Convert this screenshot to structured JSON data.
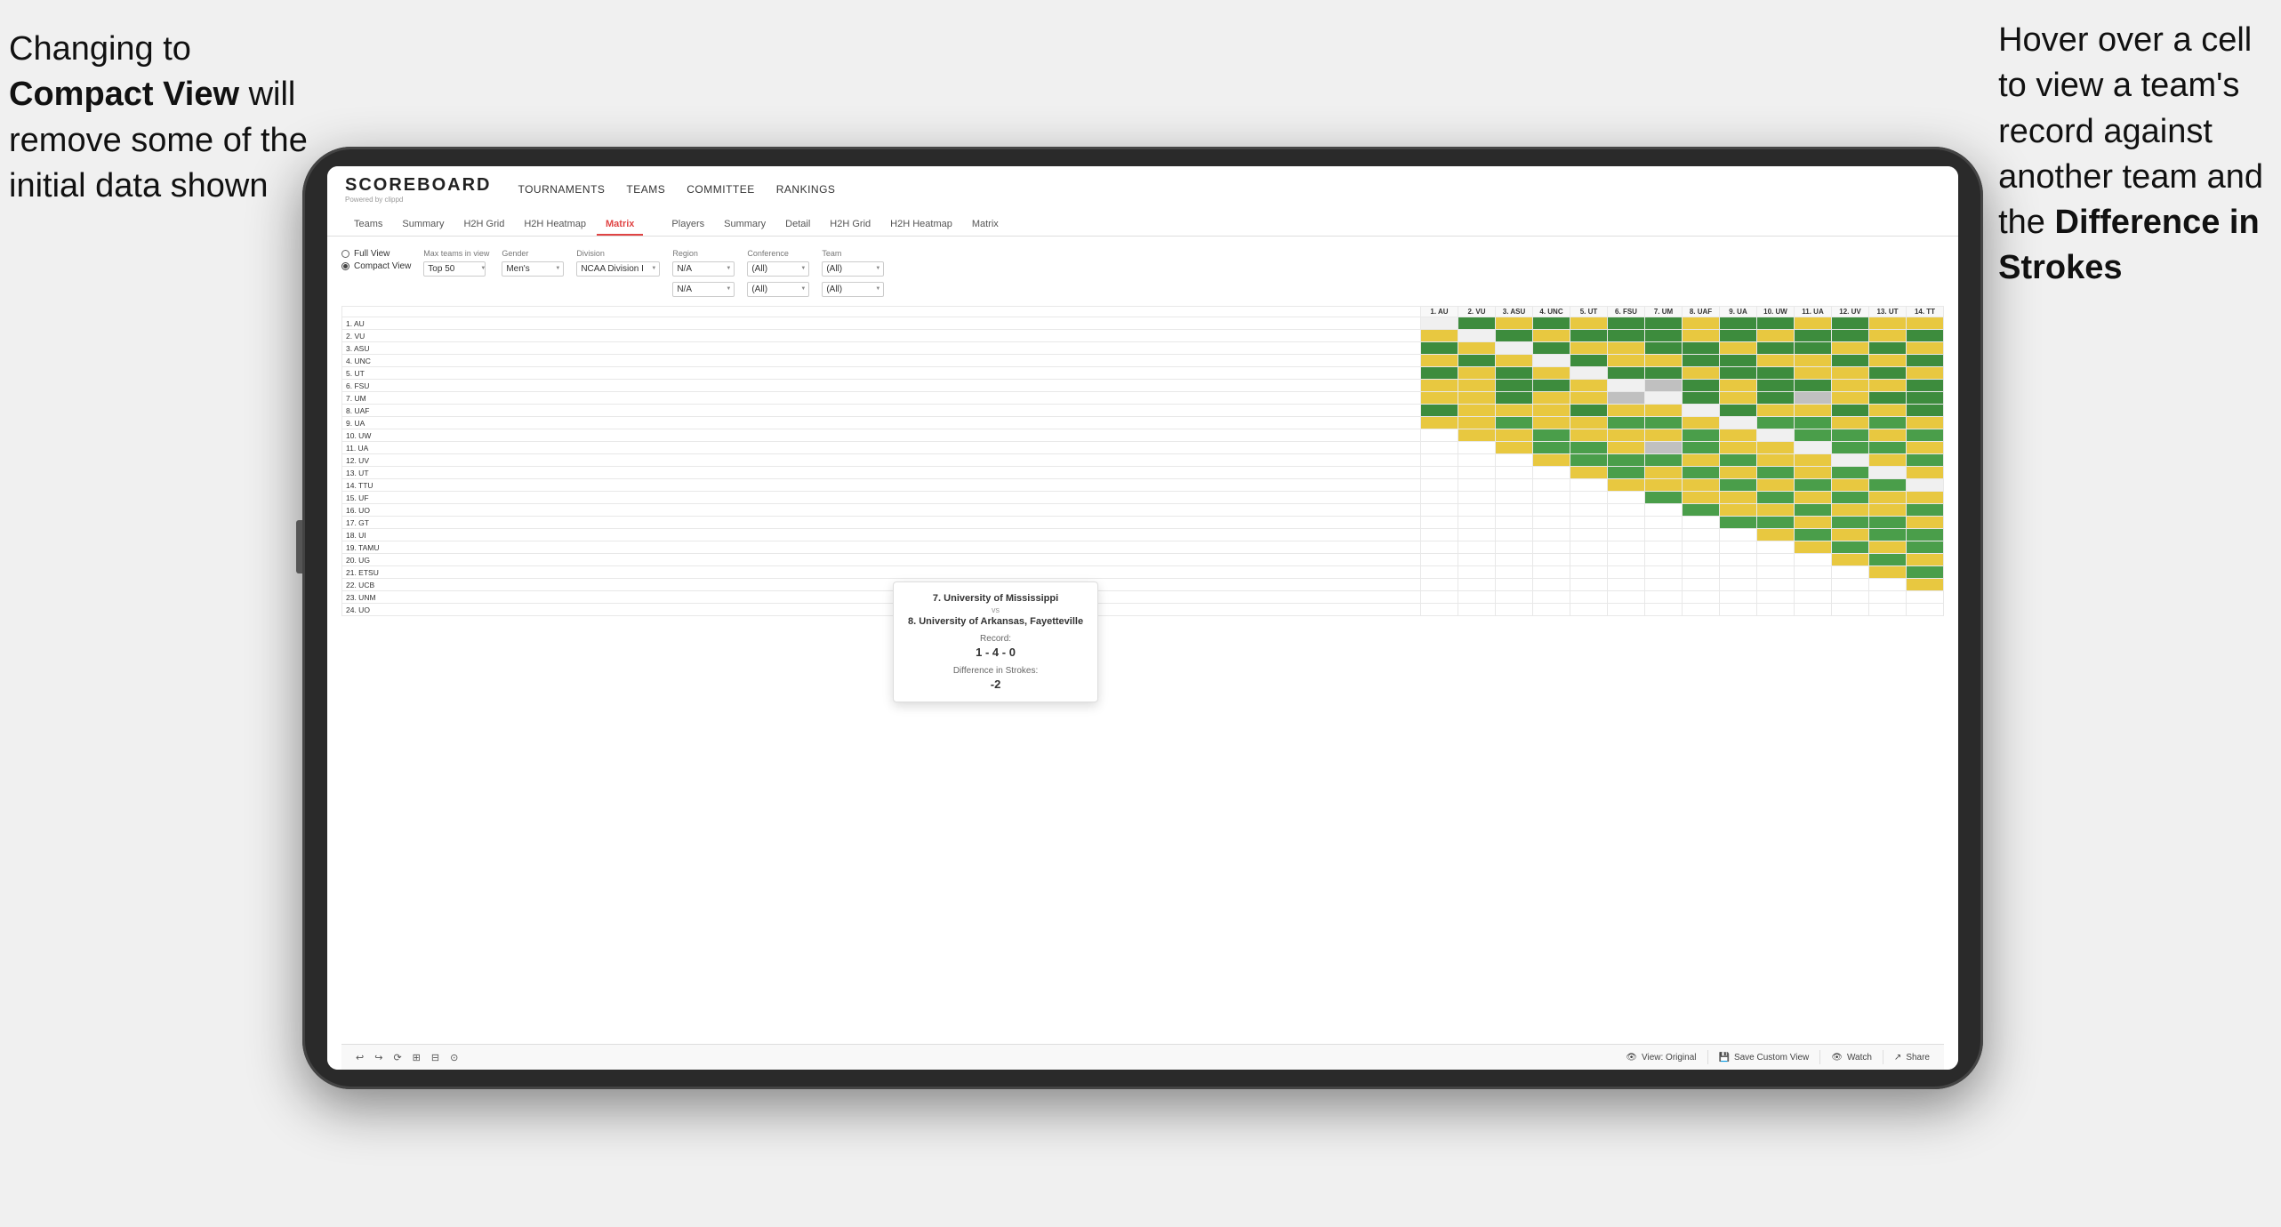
{
  "annotation_left": {
    "line1": "Changing to",
    "line2_bold": "Compact View",
    "line2_rest": " will",
    "line3": "remove some of the",
    "line4": "initial data shown"
  },
  "annotation_right": {
    "line1": "Hover over a cell",
    "line2": "to view a team's",
    "line3": "record against",
    "line4": "another team and",
    "line5_pre": "the ",
    "line5_bold": "Difference in",
    "line6_bold": "Strokes"
  },
  "nav": {
    "logo": "SCOREBOARD",
    "logo_sub": "Powered by clippd",
    "links": [
      "TOURNAMENTS",
      "TEAMS",
      "COMMITTEE",
      "RANKINGS"
    ]
  },
  "sub_tabs": {
    "group1": [
      "Teams",
      "Summary",
      "H2H Grid",
      "H2H Heatmap",
      "Matrix"
    ],
    "group2": [
      "Players",
      "Summary",
      "Detail",
      "H2H Grid",
      "H2H Heatmap",
      "Matrix"
    ],
    "active": "Matrix"
  },
  "controls": {
    "view_label": "view",
    "full_view": "Full View",
    "compact_view": "Compact View",
    "compact_selected": true,
    "filters": {
      "max_teams_label": "Max teams in view",
      "max_teams_value": "Top 50",
      "gender_label": "Gender",
      "gender_value": "Men's",
      "division_label": "Division",
      "division_value": "NCAA Division I",
      "region_label": "Region",
      "region_value": "N/A",
      "conference_label": "Conference",
      "conference_value": "(All)",
      "team_label": "Team",
      "team_value": "(All)"
    }
  },
  "matrix_headers": [
    "1. AU",
    "2. VU",
    "3. ASU",
    "4. UNC",
    "5. UT",
    "6. FSU",
    "7. UM",
    "8. UAF",
    "9. UA",
    "10. UW",
    "11. UA",
    "12. UV",
    "13. UT",
    "14. TT"
  ],
  "matrix_rows": [
    {
      "label": "1. AU",
      "cells": [
        "diag",
        "green",
        "yellow",
        "green",
        "yellow",
        "green",
        "green",
        "yellow",
        "green",
        "green",
        "yellow",
        "green",
        "yellow",
        "yellow"
      ]
    },
    {
      "label": "2. VU",
      "cells": [
        "yellow",
        "diag",
        "green",
        "yellow",
        "green",
        "green",
        "green",
        "yellow",
        "green",
        "yellow",
        "green",
        "green",
        "yellow",
        "green"
      ]
    },
    {
      "label": "3. ASU",
      "cells": [
        "green",
        "yellow",
        "diag",
        "green",
        "yellow",
        "yellow",
        "green",
        "green",
        "yellow",
        "green",
        "green",
        "yellow",
        "green",
        "yellow"
      ]
    },
    {
      "label": "4. UNC",
      "cells": [
        "yellow",
        "green",
        "yellow",
        "diag",
        "green",
        "yellow",
        "yellow",
        "green",
        "green",
        "yellow",
        "yellow",
        "green",
        "yellow",
        "green"
      ]
    },
    {
      "label": "5. UT",
      "cells": [
        "green",
        "yellow",
        "green",
        "yellow",
        "diag",
        "green",
        "green",
        "yellow",
        "green",
        "green",
        "yellow",
        "yellow",
        "green",
        "yellow"
      ]
    },
    {
      "label": "6. FSU",
      "cells": [
        "yellow",
        "yellow",
        "green",
        "green",
        "yellow",
        "diag",
        "gray",
        "green",
        "yellow",
        "green",
        "green",
        "yellow",
        "yellow",
        "green"
      ]
    },
    {
      "label": "7. UM",
      "cells": [
        "yellow",
        "yellow",
        "green",
        "yellow",
        "yellow",
        "gray",
        "diag",
        "green",
        "yellow",
        "green",
        "gray",
        "yellow",
        "green",
        "green"
      ]
    },
    {
      "label": "8. UAF",
      "cells": [
        "green",
        "yellow",
        "yellow",
        "yellow",
        "green",
        "yellow",
        "yellow",
        "diag",
        "green",
        "yellow",
        "yellow",
        "green",
        "yellow",
        "green"
      ]
    },
    {
      "label": "9. UA",
      "cells": [
        "yellow",
        "yellow",
        "green",
        "yellow",
        "yellow",
        "green",
        "green",
        "yellow",
        "diag",
        "green",
        "green",
        "yellow",
        "green",
        "yellow"
      ]
    },
    {
      "label": "10. UW",
      "cells": [
        "white",
        "yellow",
        "yellow",
        "green",
        "yellow",
        "yellow",
        "yellow",
        "green",
        "yellow",
        "diag",
        "green",
        "green",
        "yellow",
        "green"
      ]
    },
    {
      "label": "11. UA",
      "cells": [
        "white",
        "white",
        "yellow",
        "green",
        "green",
        "yellow",
        "gray",
        "green",
        "yellow",
        "yellow",
        "diag",
        "green",
        "green",
        "yellow"
      ]
    },
    {
      "label": "12. UV",
      "cells": [
        "white",
        "white",
        "white",
        "yellow",
        "green",
        "green",
        "green",
        "yellow",
        "green",
        "yellow",
        "yellow",
        "diag",
        "yellow",
        "green"
      ]
    },
    {
      "label": "13. UT",
      "cells": [
        "white",
        "white",
        "white",
        "white",
        "yellow",
        "green",
        "yellow",
        "green",
        "yellow",
        "green",
        "yellow",
        "green",
        "diag",
        "yellow"
      ]
    },
    {
      "label": "14. TTU",
      "cells": [
        "white",
        "white",
        "white",
        "white",
        "white",
        "yellow",
        "yellow",
        "yellow",
        "green",
        "yellow",
        "green",
        "yellow",
        "green",
        "diag"
      ]
    },
    {
      "label": "15. UF",
      "cells": [
        "white",
        "white",
        "white",
        "white",
        "white",
        "white",
        "green",
        "yellow",
        "yellow",
        "green",
        "yellow",
        "green",
        "yellow",
        "yellow"
      ]
    },
    {
      "label": "16. UO",
      "cells": [
        "white",
        "white",
        "white",
        "white",
        "white",
        "white",
        "white",
        "green",
        "yellow",
        "yellow",
        "green",
        "yellow",
        "yellow",
        "green"
      ]
    },
    {
      "label": "17. GT",
      "cells": [
        "white",
        "white",
        "white",
        "white",
        "white",
        "white",
        "white",
        "white",
        "green",
        "green",
        "yellow",
        "green",
        "green",
        "yellow"
      ]
    },
    {
      "label": "18. UI",
      "cells": [
        "white",
        "white",
        "white",
        "white",
        "white",
        "white",
        "white",
        "white",
        "white",
        "yellow",
        "green",
        "yellow",
        "green",
        "green"
      ]
    },
    {
      "label": "19. TAMU",
      "cells": [
        "white",
        "white",
        "white",
        "white",
        "white",
        "white",
        "white",
        "white",
        "white",
        "white",
        "yellow",
        "green",
        "yellow",
        "green"
      ]
    },
    {
      "label": "20. UG",
      "cells": [
        "white",
        "white",
        "white",
        "white",
        "white",
        "white",
        "white",
        "white",
        "white",
        "white",
        "white",
        "yellow",
        "green",
        "yellow"
      ]
    },
    {
      "label": "21. ETSU",
      "cells": [
        "white",
        "white",
        "white",
        "white",
        "white",
        "white",
        "white",
        "white",
        "white",
        "white",
        "white",
        "white",
        "yellow",
        "green"
      ]
    },
    {
      "label": "22. UCB",
      "cells": [
        "white",
        "white",
        "white",
        "white",
        "white",
        "white",
        "white",
        "white",
        "white",
        "white",
        "white",
        "white",
        "white",
        "yellow"
      ]
    },
    {
      "label": "23. UNM",
      "cells": [
        "white",
        "white",
        "white",
        "white",
        "white",
        "white",
        "white",
        "white",
        "white",
        "white",
        "white",
        "white",
        "white",
        "white"
      ]
    },
    {
      "label": "24. UO",
      "cells": [
        "white",
        "white",
        "white",
        "white",
        "white",
        "white",
        "white",
        "white",
        "white",
        "white",
        "white",
        "white",
        "white",
        "white"
      ]
    }
  ],
  "tooltip": {
    "team1": "7. University of Mississippi",
    "vs": "vs",
    "team2": "8. University of Arkansas, Fayetteville",
    "record_label": "Record:",
    "record_value": "1 - 4 - 0",
    "diff_label": "Difference in Strokes:",
    "diff_value": "-2"
  },
  "toolbar": {
    "undo": "↩",
    "redo": "↪",
    "icon1": "⟳",
    "icon2": "⊞",
    "icon3": "⊟",
    "icon4": "⊙",
    "view_original": "View: Original",
    "save_custom": "Save Custom View",
    "watch": "Watch",
    "share": "Share"
  }
}
